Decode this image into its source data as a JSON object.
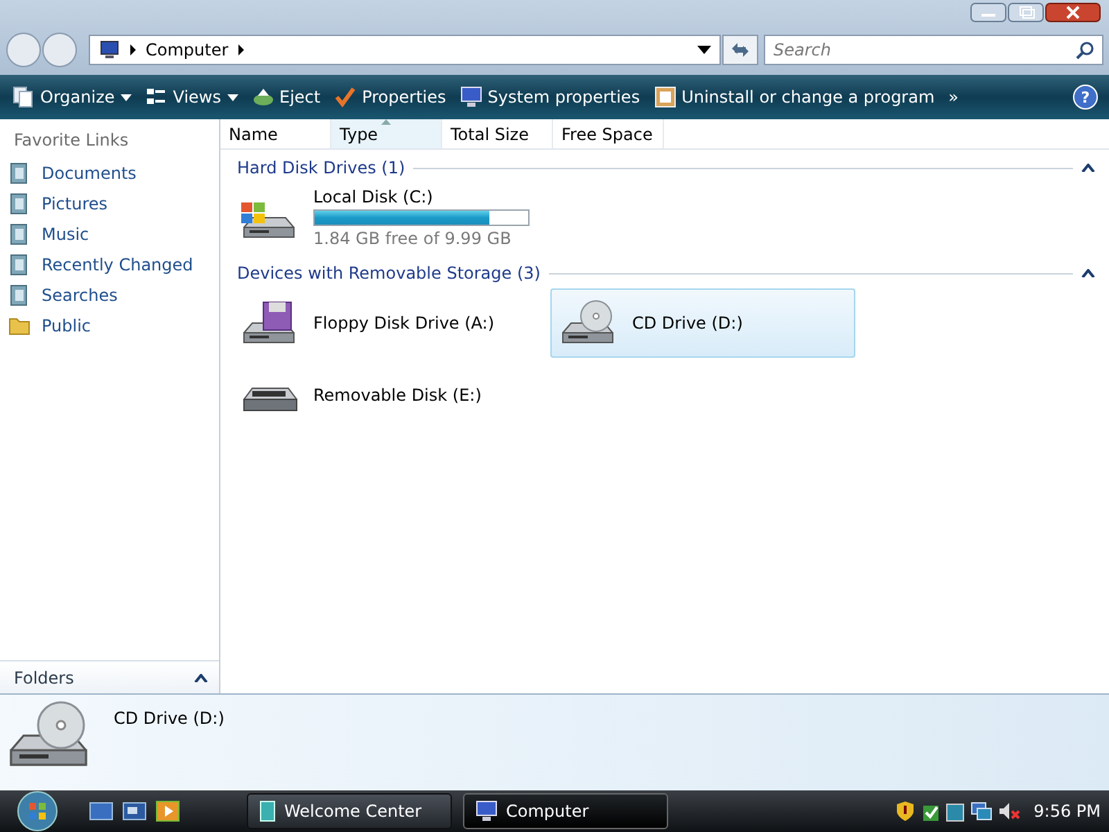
{
  "address": {
    "crumbs": [
      "Computer"
    ]
  },
  "search": {
    "placeholder": "Search"
  },
  "toolbar": [
    {
      "label": "Organize",
      "dropdown": true
    },
    {
      "label": "Views",
      "dropdown": true
    },
    {
      "label": "Eject",
      "dropdown": false
    },
    {
      "label": "Properties",
      "dropdown": false
    },
    {
      "label": "System properties",
      "dropdown": false
    },
    {
      "label": "Uninstall or change a program",
      "dropdown": false
    }
  ],
  "toolbar_more": "»",
  "help": "?",
  "sidebar": {
    "heading": "Favorite Links",
    "items": [
      {
        "label": "Documents"
      },
      {
        "label": "Pictures"
      },
      {
        "label": "Music"
      },
      {
        "label": "Recently Changed"
      },
      {
        "label": "Searches"
      },
      {
        "label": "Public"
      }
    ],
    "folders": "Folders"
  },
  "columns": [
    {
      "label": "Name",
      "selected": false
    },
    {
      "label": "Type",
      "selected": true
    },
    {
      "label": "Total Size",
      "selected": false
    },
    {
      "label": "Free Space",
      "selected": false
    }
  ],
  "groups": [
    {
      "title": "Hard Disk Drives (1)",
      "items": [
        {
          "kind": "disk",
          "name": "Local Disk (C:)",
          "level": 0.82,
          "free": "1.84 GB free of 9.99 GB",
          "selected": false
        }
      ]
    },
    {
      "title": "Devices with Removable Storage (3)",
      "items": [
        {
          "kind": "floppy",
          "name": "Floppy Disk Drive (A:)",
          "selected": false
        },
        {
          "kind": "cd",
          "name": "CD Drive (D:)",
          "selected": true
        },
        {
          "kind": "removable",
          "name": "Removable Disk (E:)",
          "selected": false
        }
      ]
    }
  ],
  "details": {
    "name": "CD Drive (D:)"
  },
  "taskbar": {
    "buttons": [
      {
        "label": "Welcome Center",
        "selected": false
      },
      {
        "label": "Computer",
        "selected": true
      }
    ],
    "clock": "9:56 PM"
  }
}
